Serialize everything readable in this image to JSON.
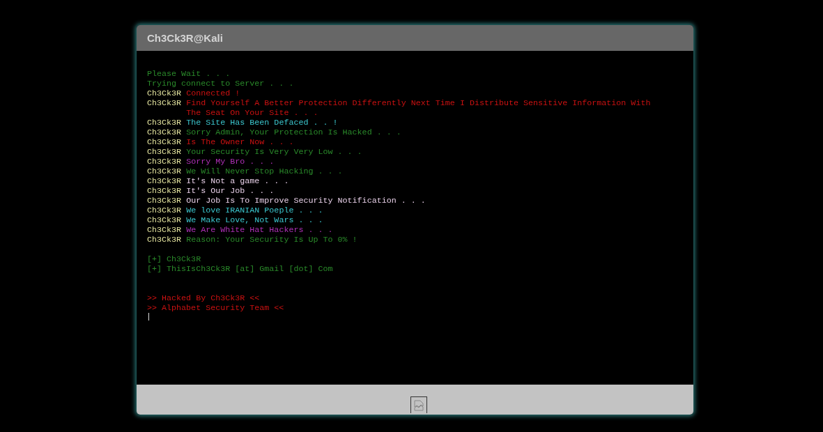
{
  "window": {
    "title": "Ch3Ck3R@Kali"
  },
  "log": [
    {
      "text": "Please Wait . . .",
      "color": "#2a8a2a"
    },
    {
      "text": "Trying connect to Server . . .",
      "color": "#2a8a2a"
    },
    {
      "prefix": "Ch3Ck3R",
      "text": "Connected !",
      "color": "#cc1111"
    },
    {
      "prefix": "Ch3Ck3R",
      "text": "Find Yourself A Better Protection Differently Next Time I Distribute Sensitive Information With The Seat On Your Site . . .",
      "color": "#cc1111"
    },
    {
      "prefix": "Ch3Ck3R",
      "text": "The Site Has Been Defaced . . !",
      "color": "#3cc8d0"
    },
    {
      "prefix": "Ch3Ck3R",
      "text": "Sorry Admin, Your Protection Is Hacked . . .",
      "color": "#2a8a2a"
    },
    {
      "prefix": "Ch3Ck3R",
      "text": "Is The Owner Now . . .",
      "color": "#cc1111"
    },
    {
      "prefix": "Ch3Ck3R",
      "text": "Your Security Is Very Very Low . . .",
      "color": "#2a8a2a"
    },
    {
      "prefix": "Ch3Ck3R",
      "text": "Sorry My Bro . . .",
      "color": "#b030b8"
    },
    {
      "prefix": "Ch3Ck3R",
      "text": "We Will Never Stop Hacking . . .",
      "color": "#2a8a2a"
    },
    {
      "prefix": "Ch3Ck3R",
      "text": "It's Not a game . . .",
      "color": "#e8d0e8"
    },
    {
      "prefix": "Ch3Ck3R",
      "text": "It's Our Job . . .",
      "color": "#e8d0e8"
    },
    {
      "prefix": "Ch3Ck3R",
      "text": "Our Job Is To Improve Security Notification . . .",
      "color": "#e8d0e8"
    },
    {
      "prefix": "Ch3Ck3R",
      "text": "We love IRANIAN Poeple . . .",
      "color": "#3cc8d0"
    },
    {
      "prefix": "Ch3Ck3R",
      "text": "We Make Love, Not Wars . . .",
      "color": "#3cc8d0"
    },
    {
      "prefix": "Ch3Ck3R",
      "text": "We Are White Hat Hackers . . .",
      "color": "#b030b8"
    },
    {
      "prefix": "Ch3Ck3R",
      "text": "Reason: Your Security Is Up To 0% !",
      "color": "#2a8a2a"
    }
  ],
  "contacts": [
    "[+] Ch3Ck3R",
    "[+] ThisIsCh3Ck3R [at] Gmail [dot] Com"
  ],
  "signature": [
    ">> Hacked By Ch3Ck3R <<",
    ">> Alphabet Security Team <<"
  ]
}
